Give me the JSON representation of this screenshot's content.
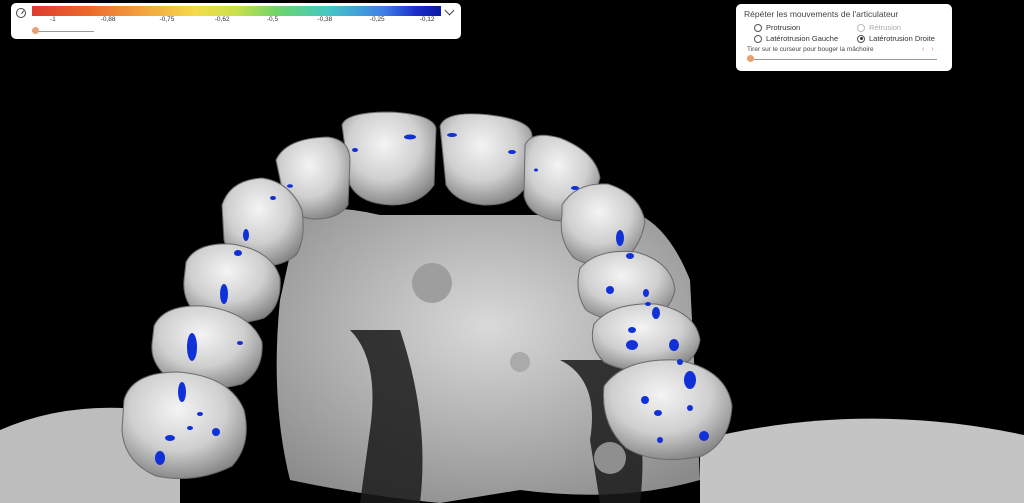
{
  "scale": {
    "icon": "gauge-icon",
    "ticks": [
      "-1",
      "-0,88",
      "-0,75",
      "-0,62",
      "-0,5",
      "-0,38",
      "-0,25",
      "-0,12"
    ],
    "colors": [
      "#e03a2f",
      "#ec6a2c",
      "#f3a640",
      "#f4dc4b",
      "#6fd46a",
      "#46c9c3",
      "#3f7fe8",
      "#0b1aa6"
    ],
    "expand_icon": "chevron-down-icon",
    "slider_value": 0
  },
  "articulator": {
    "title": "Répéter les mouvements de l'articulateur",
    "options": {
      "protrusion": "Protrusion",
      "retrusion": "Rétrusion",
      "laterotrusion_left": "Latérotrusion Gauche",
      "laterotrusion_right": "Latérotrusion Droite"
    },
    "selected": "Latérotrusion Droite",
    "disabled": [
      "Rétrusion"
    ],
    "hint": "Tirer sur le curseur pour bouger la mâchoire",
    "prev_icon": "‹",
    "next_icon": "›",
    "slider_value": 0
  },
  "viewer": {
    "background": "#000000",
    "teeth_color": "#cfcfcf",
    "contact_color": "#1030d8"
  }
}
